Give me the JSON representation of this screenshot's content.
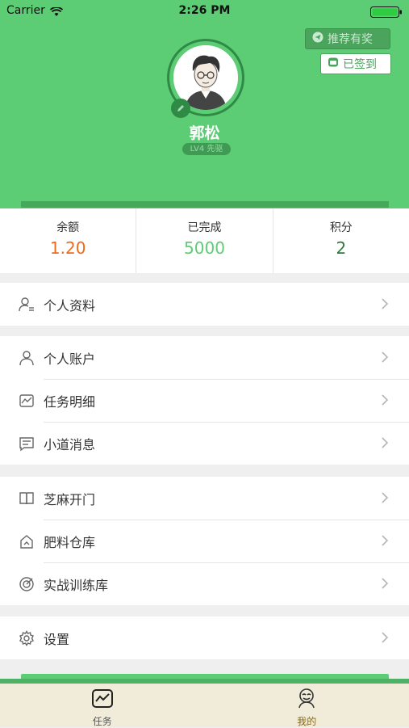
{
  "status_bar": {
    "carrier": "Carrier",
    "time": "2:26 PM"
  },
  "header": {
    "recommend_label": "推荐有奖",
    "signed_label": "已签到",
    "username": "郭松",
    "level": "LV4 先驱"
  },
  "stats": [
    {
      "label": "余额",
      "value": "1.20",
      "color": "#ef6a1e"
    },
    {
      "label": "已完成",
      "value": "5000",
      "color": "#5dcd75"
    },
    {
      "label": "积分",
      "value": "2",
      "color": "#2f7a3b"
    }
  ],
  "menu": {
    "group1": [
      {
        "label": "个人资料",
        "icon": "profile-icon"
      }
    ],
    "group2": [
      {
        "label": "个人账户",
        "icon": "account-icon"
      },
      {
        "label": "任务明细",
        "icon": "chart-icon"
      },
      {
        "label": "小道消息",
        "icon": "message-icon"
      }
    ],
    "group3": [
      {
        "label": "芝麻开门",
        "icon": "book-icon"
      },
      {
        "label": "肥料仓库",
        "icon": "warehouse-icon"
      },
      {
        "label": "实战训练库",
        "icon": "target-icon"
      }
    ],
    "group4": [
      {
        "label": "设置",
        "icon": "gear-icon"
      }
    ]
  },
  "tabbar": {
    "tasks_label": "任务",
    "mine_label": "我的"
  },
  "colors": {
    "brand_green": "#5dcd75",
    "tab_active": "#8a6a12"
  }
}
